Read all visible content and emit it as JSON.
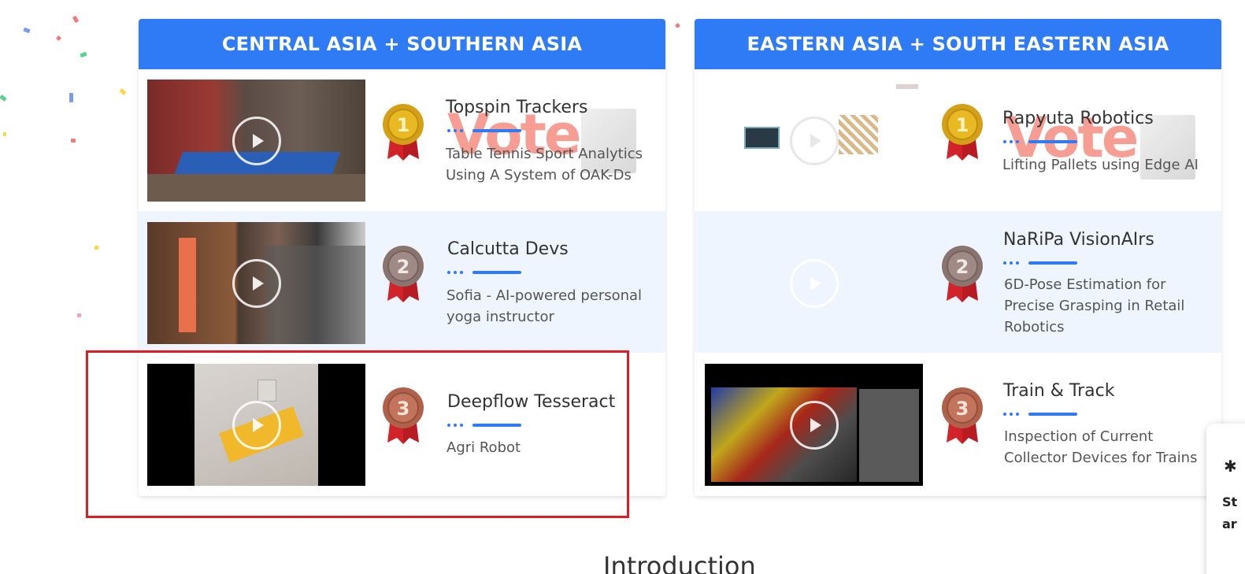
{
  "panels": [
    {
      "title": "CENTRAL ASIA + SOUTHERN ASIA",
      "entries": [
        {
          "rank": "1",
          "team": "Topspin Trackers",
          "description": "Table Tennis Sport Analytics Using A System of OAK-Ds",
          "thumbnail": "table-tennis-video"
        },
        {
          "rank": "2",
          "team": "Calcutta Devs",
          "description": "Sofia - AI-powered personal yoga instructor",
          "thumbnail": "yoga-video"
        },
        {
          "rank": "3",
          "team": "Deepflow Tesseract",
          "description": "Agri Robot",
          "thumbnail": "agri-robot-video"
        }
      ]
    },
    {
      "title": "EASTERN ASIA + SOUTH EASTERN ASIA",
      "entries": [
        {
          "rank": "1",
          "team": "Rapyuta Robotics",
          "description": "Lifting Pallets using Edge AI",
          "thumbnail": "pallet-lifting-video"
        },
        {
          "rank": "2",
          "team": "NaRiPa VisionAIrs",
          "description": "6D-Pose Estimation for Precise Grasping in Retail Robotics",
          "thumbnail": "blank-video"
        },
        {
          "rank": "3",
          "team": "Train & Track",
          "description": "Inspection of Current Collector Devices for Trains",
          "thumbnail": "train-inspection-video"
        }
      ]
    }
  ],
  "vote_badge_text": "Vote",
  "section_heading": "Introduction",
  "side_card": {
    "line1": "St",
    "line2": "ar"
  },
  "colors": {
    "header": "#2f7bf5",
    "gold": "#d4a017",
    "silver": "#9a8580",
    "bronze": "#b86b52",
    "highlight": "#e01b24"
  }
}
